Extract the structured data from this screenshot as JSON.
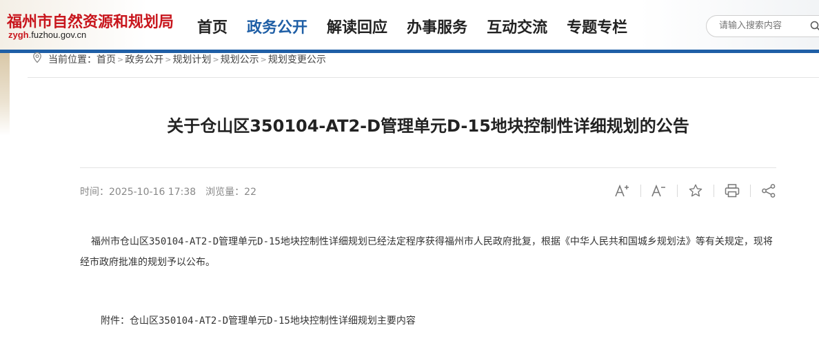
{
  "site": {
    "name": "福州市自然资源和规划局",
    "domain_prefix": "zygh",
    "domain_suffix": ".fuzhou.gov.cn"
  },
  "nav": {
    "items": [
      {
        "label": "首页"
      },
      {
        "label": "政务公开"
      },
      {
        "label": "解读回应"
      },
      {
        "label": "办事服务"
      },
      {
        "label": "互动交流"
      },
      {
        "label": "专题专栏"
      }
    ],
    "active_index": 1
  },
  "search": {
    "placeholder": "请输入搜索内容",
    "icon": "search-icon"
  },
  "breadcrumb": {
    "prefix": "当前位置：",
    "items": [
      "首页",
      "政务公开",
      "规划计划",
      "规划公示",
      "规划变更公示"
    ],
    "separator": ">"
  },
  "article": {
    "title": "关于仓山区350104-AT2-D管理单元D-15地块控制性详细规划的公告",
    "time_label": "时间：",
    "time_value": "2025-10-16 17:38",
    "views_label": "浏览量：",
    "views_value": "22",
    "body": "福州市仓山区350104-AT2-D管理单元D-15地块控制性详细规划已经法定程序获得福州市人民政府批复，根据《中华人民共和国城乡规划法》等有关规定，现将经市政府批准的规划予以公布。",
    "attachment_label": "附件：",
    "attachment_name": "仓山区350104-AT2-D管理单元D-15地块控制性详细规划主要内容"
  },
  "tools": [
    "font-increase-icon",
    "font-decrease-icon",
    "star-icon",
    "print-icon",
    "share-icon"
  ],
  "colors": {
    "brand_red": "#c8161d",
    "accent_blue": "#1f5fa6"
  }
}
